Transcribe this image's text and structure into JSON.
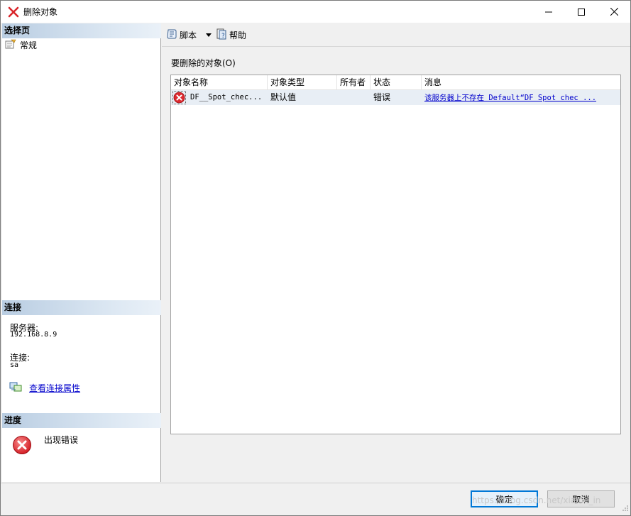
{
  "window": {
    "title": "删除对象",
    "minimize_glyph": "—",
    "maximize_glyph": "☐",
    "close_glyph": "✕"
  },
  "left": {
    "select_page_header": "选择页",
    "pages": [
      {
        "label": "常规",
        "icon": "page-settings-icon"
      }
    ],
    "connection_header": "连接",
    "server_label": "服务器:",
    "server_value": "192.168.8.9",
    "connection_label": "连接:",
    "connection_value": "sa",
    "view_connection_link": "查看连接属性",
    "progress_header": "进度",
    "progress_text": "出现错误"
  },
  "toolbar": {
    "script_label": "脚本",
    "help_label": "帮助"
  },
  "main": {
    "objects_label": "要删除的对象(O)",
    "columns": [
      "对象名称",
      "对象类型",
      "所有者",
      "状态",
      "消息"
    ],
    "rows": [
      {
        "name": "DF__Spot_chec...",
        "type": "默认值",
        "owner": "",
        "status": "错误",
        "message": "该服务器上不存在 Default“DF  Spot chec  ..."
      }
    ]
  },
  "buttons": {
    "ok": "确定",
    "cancel": "取消"
  },
  "watermark": "https://blog.csdn.net/xiaine_in",
  "colors": {
    "accent": "#0078d7",
    "link": "#0000cc",
    "error": "#e0262d",
    "section_header": "#c9d9ea"
  }
}
